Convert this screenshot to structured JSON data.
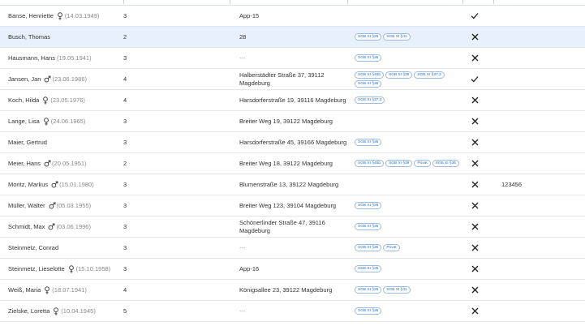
{
  "rows": [
    {
      "name": "Banse, Henriette",
      "gender": "female",
      "dob": "(14.03.1949)",
      "pflegegrad": "3",
      "address": "App-15",
      "tags": [],
      "status": "check",
      "extra": ""
    },
    {
      "name": "Busch, Thomas",
      "gender": "",
      "dob": "",
      "pflegegrad": "2",
      "address": "28",
      "tags": [
        "SGB XI §36",
        "SGB XI §41"
      ],
      "status": "cross",
      "extra": ""
    },
    {
      "name": "Hausmann, Hans",
      "gender": "",
      "dob": "(19.05.1941)",
      "pflegegrad": "3",
      "address": "---",
      "tags": [
        "SGB XI §36"
      ],
      "status": "cross",
      "extra": ""
    },
    {
      "name": "Jansen, Jan",
      "gender": "male",
      "dob": "(23.06.1986)",
      "pflegegrad": "4",
      "address": "Halberstädter Straße 37, 39112 Magdeburg",
      "tags": [
        "SGB XI §45b",
        "SGB XI §39",
        "SGB XI §37.3",
        "SGB XI §36"
      ],
      "status": "check",
      "extra": ""
    },
    {
      "name": "Koch, Hilda",
      "gender": "female",
      "dob": "(23.05.1976)",
      "pflegegrad": "4",
      "address": "Harsdorferstraße 19, 39116 Magdeburg",
      "tags": [
        "SGB XI §37.3"
      ],
      "status": "cross",
      "extra": ""
    },
    {
      "name": "Lange, Lisa",
      "gender": "female",
      "dob": "(24.06.1965)",
      "pflegegrad": "3",
      "address": "Breiter Weg 19, 39122 Magdeburg",
      "tags": [],
      "status": "cross",
      "extra": ""
    },
    {
      "name": "Maier, Gertrud",
      "gender": "",
      "dob": "",
      "pflegegrad": "3",
      "address": "Harsdorferstraße 45, 39166 Magdeburg",
      "tags": [
        "SGB XI §36"
      ],
      "status": "cross",
      "extra": ""
    },
    {
      "name": "Meier, Hans",
      "gender": "male",
      "dob": "(20.05.1951)",
      "pflegegrad": "2",
      "address": "Breiter Weg 18, 39122 Magdeburg",
      "tags": [
        "SGB XI §45b",
        "SGB XI §39",
        "Privat",
        "SGB XI §36"
      ],
      "status": "cross",
      "extra": ""
    },
    {
      "name": "Moritz, Markus",
      "gender": "male",
      "dob": "(15.01.1980)",
      "pflegegrad": "3",
      "address": "Blumenstraße 13, 39122 Magdeburg",
      "tags": [],
      "status": "cross",
      "extra": "123456"
    },
    {
      "name": "Müller, Walter",
      "gender": "male",
      "dob": "(05.03.1955)",
      "pflegegrad": "3",
      "address": "Breiter Weg 123, 39104 Magdeburg",
      "tags": [
        "SGB XI §36"
      ],
      "status": "cross",
      "extra": ""
    },
    {
      "name": "Schmidt, Max",
      "gender": "male",
      "dob": "(03.06.1996)",
      "pflegegrad": "3",
      "address": "Schönerlinder Straße 47, 39116 Magdeburg",
      "tags": [
        "SGB XI §36"
      ],
      "status": "cross",
      "extra": ""
    },
    {
      "name": "Steinmetz, Conrad",
      "gender": "",
      "dob": "",
      "pflegegrad": "3",
      "address": "---",
      "tags": [
        "SGB XI §36",
        "Privat"
      ],
      "status": "cross",
      "extra": ""
    },
    {
      "name": "Steinmetz, Lieselotte",
      "gender": "female",
      "dob": "(15.10.1958)",
      "pflegegrad": "3",
      "address": "App-16",
      "tags": [
        "SGB XI §36"
      ],
      "status": "cross",
      "extra": ""
    },
    {
      "name": "Weiß, Maria",
      "gender": "female",
      "dob": "(18.07.1941)",
      "pflegegrad": "4",
      "address": "Königsallee 23, 39122 Magdeburg",
      "tags": [
        "SGB XI §36",
        "SGB XI §41"
      ],
      "status": "cross",
      "extra": ""
    },
    {
      "name": "Zielske, Loretta",
      "gender": "female",
      "dob": "(10.04.1945)",
      "pflegegrad": "5",
      "address": "---",
      "tags": [
        "SGB XI §36"
      ],
      "status": "cross",
      "extra": ""
    }
  ],
  "selected_row": 1,
  "colors": {
    "selected_bg": "#e7f0fb",
    "tag_border": "#9bbbe0",
    "tag_text": "#2c6fb8"
  }
}
